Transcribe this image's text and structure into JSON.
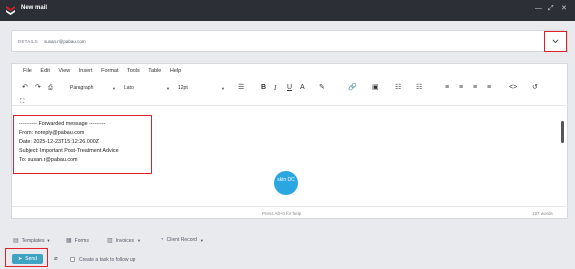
{
  "window": {
    "title": "New mail"
  },
  "details": {
    "label": "DETAILS",
    "recipient": "susan.r@pabau.com"
  },
  "menu": [
    "File",
    "Edit",
    "View",
    "Insert",
    "Format",
    "Tools",
    "Table",
    "Help"
  ],
  "toolbar": {
    "block_format": "Paragraph",
    "font_family": "Lato",
    "font_size": "12pt"
  },
  "message": {
    "header": "---------- Forwarded message ---------",
    "from": "From: noreply@pabau.com",
    "date": "Date: 2025-12-23T15:12:26.000Z",
    "subject": "Subject: Important Post-Treatment Advice",
    "to": "To: susan.r@pabau.com",
    "logo_text": "skin DC"
  },
  "status": {
    "help": "Press Alt+0 for help",
    "words": "197 words"
  },
  "bottom_tools": {
    "templates": "Templates",
    "forms": "Forms",
    "invoices": "Invoices",
    "client_record": "Client Record"
  },
  "send": {
    "label": "Send"
  },
  "task": {
    "label": "Create a task to follow up"
  },
  "colors": {
    "accent": "#3fa3c3",
    "titlebar": "#2c2f36",
    "highlight": "#e0212b"
  }
}
